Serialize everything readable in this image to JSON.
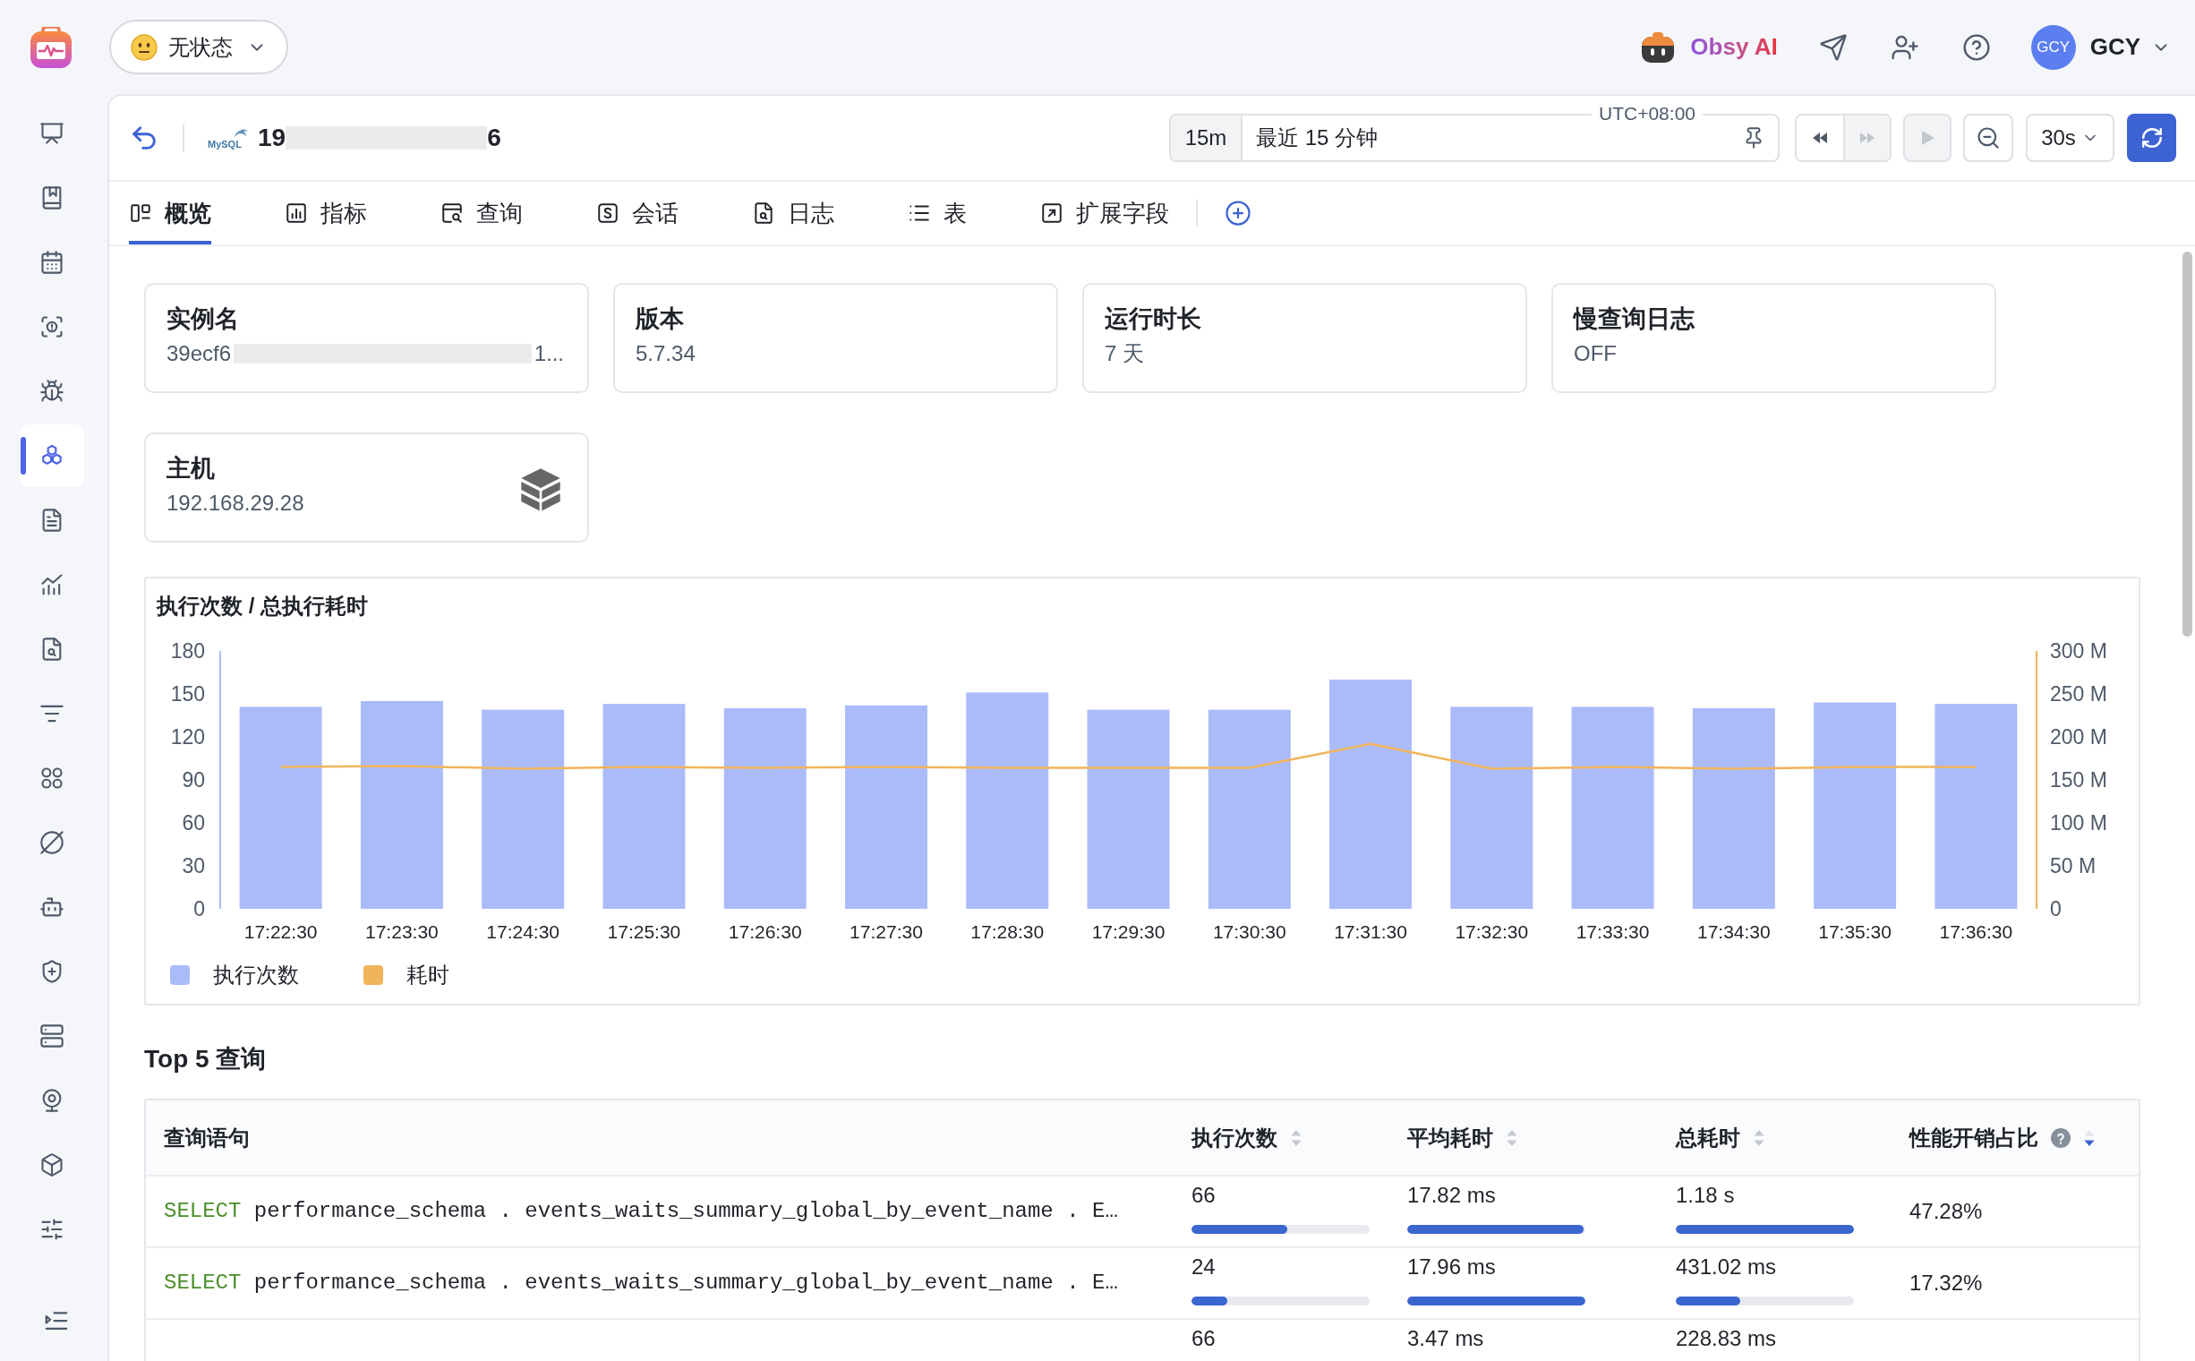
{
  "top_bar": {
    "status": {
      "label": "无状态"
    },
    "assistant": {
      "label": "Obsy AI"
    },
    "user": {
      "initials": "GCY",
      "name": "GCY"
    }
  },
  "sidebar": {
    "items": [
      {
        "selected": false
      },
      {
        "selected": false
      },
      {
        "selected": false
      },
      {
        "selected": false
      },
      {
        "selected": false
      },
      {
        "selected": true
      },
      {
        "selected": false
      },
      {
        "selected": false
      },
      {
        "selected": false
      },
      {
        "selected": false
      },
      {
        "selected": false
      },
      {
        "selected": false
      },
      {
        "selected": false
      },
      {
        "selected": false
      },
      {
        "selected": false
      },
      {
        "selected": false
      },
      {
        "selected": false
      },
      {
        "selected": false
      }
    ]
  },
  "header": {
    "logo_text": "MySQL",
    "title_parts": [
      "19",
      "6"
    ],
    "time_range": {
      "short": "15m",
      "label": "最近 15 分钟",
      "timezone": "UTC+08:00"
    },
    "step_buttons": [
      {
        "kind": "rewind",
        "disabled": false
      },
      {
        "kind": "forward",
        "disabled": true
      }
    ],
    "play_button": {
      "disabled": true
    },
    "refresh_interval": "30s"
  },
  "tabs": [
    {
      "label": "概览",
      "selected": true
    },
    {
      "label": "指标",
      "selected": false
    },
    {
      "label": "查询",
      "selected": false
    },
    {
      "label": "会话",
      "selected": false
    },
    {
      "label": "日志",
      "selected": false
    },
    {
      "label": "表",
      "selected": false
    },
    {
      "label": "扩展字段",
      "selected": false
    }
  ],
  "cards": [
    {
      "kind": "plain",
      "title": "实例名",
      "value_parts": [
        "39ecf6",
        "1..."
      ]
    },
    {
      "kind": "plain",
      "title": "版本",
      "value_parts": [
        "5.7.34"
      ]
    },
    {
      "kind": "plain",
      "title": "运行时长",
      "value_parts": [
        "7 天"
      ]
    },
    {
      "kind": "plain",
      "title": "慢查询日志",
      "value_parts": [
        "OFF"
      ]
    },
    {
      "kind": "host",
      "title": "主机",
      "value_parts": [
        "192.168.29.28"
      ]
    }
  ],
  "chart": {
    "chart_data": {
      "type": "bar",
      "title": "执行次数 / 总执行耗时",
      "categories": [
        "17:22:30",
        "17:23:30",
        "17:24:30",
        "17:25:30",
        "17:26:30",
        "17:27:30",
        "17:28:30",
        "17:29:30",
        "17:30:30",
        "17:31:30",
        "17:32:30",
        "17:33:30",
        "17:34:30",
        "17:35:30",
        "17:36:30"
      ],
      "series": [
        {
          "name": "执行次数",
          "color": "#abbbf9",
          "values": [
            141,
            145,
            139,
            143,
            140,
            142,
            151,
            139,
            139,
            160,
            141,
            141,
            140,
            144,
            143
          ]
        },
        {
          "name": "耗时",
          "color": "#f0b45a",
          "type": "line",
          "axis": "y2",
          "values": [
            165,
            166,
            163,
            165,
            164,
            165,
            164,
            164,
            164,
            192,
            163,
            165,
            163,
            165,
            165
          ]
        }
      ],
      "ylim": [
        0,
        180
      ],
      "yticks": [
        0,
        30,
        60,
        90,
        120,
        150,
        180
      ],
      "y2lim": [
        0,
        300
      ],
      "y2ticks": [
        {
          "value": 0,
          "label": "0"
        },
        {
          "value": 50,
          "label": "50 M"
        },
        {
          "value": 100,
          "label": "100 M"
        },
        {
          "value": 150,
          "label": "150 M"
        },
        {
          "value": 200,
          "label": "200 M"
        },
        {
          "value": 250,
          "label": "250 M"
        },
        {
          "value": 300,
          "label": "300 M"
        }
      ],
      "legend": "bottom-left"
    }
  },
  "top_queries": {
    "title": "Top 5 查询",
    "columns": [
      {
        "label": "查询语句",
        "help": false,
        "sortable": false
      },
      {
        "label": "执行次数",
        "help": false,
        "sortable": true,
        "sorted": false
      },
      {
        "label": "平均耗时",
        "help": false,
        "sortable": true,
        "sorted": false
      },
      {
        "label": "总耗时",
        "help": false,
        "sortable": true,
        "sorted": false
      },
      {
        "label": "性能开销占比",
        "help": true,
        "sortable": true,
        "sorted": true
      }
    ],
    "rows": [
      {
        "query": {
          "keyword": "SELECT",
          "rest": "performance_schema . events_waits_summary_global_by_event_name . E…"
        },
        "count": {
          "text": "66",
          "level": 0.54
        },
        "avg": {
          "text": "17.82 ms",
          "level": 0.99
        },
        "total": {
          "text": "1.18 s",
          "level": 1
        },
        "share": "47.28%"
      },
      {
        "query": {
          "keyword": "SELECT",
          "rest": "performance_schema . events_waits_summary_global_by_event_name . E…"
        },
        "count": {
          "text": "24",
          "level": 0.2
        },
        "avg": {
          "text": "17.96 ms",
          "level": 1
        },
        "total": {
          "text": "431.02 ms",
          "level": 0.36
        },
        "share": "17.32%"
      },
      {
        "count": {
          "text": "66"
        },
        "avg": {
          "text": "3.47 ms"
        },
        "total": {
          "text": "228.83 ms"
        }
      }
    ]
  }
}
